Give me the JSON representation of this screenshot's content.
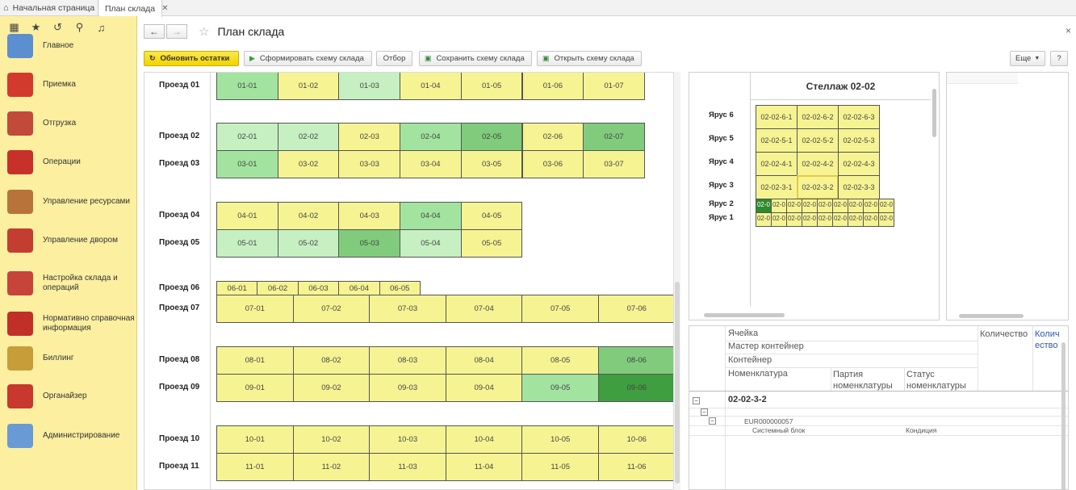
{
  "tabs": {
    "home": "Начальная страница",
    "current": "План склада"
  },
  "sidebar": {
    "items": [
      {
        "label": "Главное",
        "color": "#5b8fd0"
      },
      {
        "label": "Приемка",
        "color": "#d23a2e"
      },
      {
        "label": "Отгрузка",
        "color": "#c24a3a"
      },
      {
        "label": "Операции",
        "color": "#c8302a"
      },
      {
        "label": "Управление ресурсами",
        "color": "#b8733a"
      },
      {
        "label": "Управление двором",
        "color": "#c33d30"
      },
      {
        "label": "Настройка склада и операций",
        "color": "#c7443a"
      },
      {
        "label": "Нормативно справочная информация",
        "color": "#c03028"
      },
      {
        "label": "Биллинг",
        "color": "#c79d3a"
      },
      {
        "label": "Органайзер",
        "color": "#c8382e"
      },
      {
        "label": "Администрирование",
        "color": "#6a9ad6"
      }
    ]
  },
  "header": {
    "title": "План склада",
    "close": "×"
  },
  "toolbar": {
    "refresh": "Обновить остатки",
    "form_scheme": "Сформировать схему склада",
    "filter": "Отбор",
    "save_scheme": "Сохранить схему склада",
    "open_scheme": "Открыть схему склада",
    "more": "Еще",
    "help": "?"
  },
  "colors": {
    "yellow": "#f6f492",
    "light_green": "#c6f0c2",
    "mid_green": "#a3e3a0",
    "green": "#80cc7c",
    "dark_green": "#3f9e3f"
  },
  "passages": [
    {
      "label": "Проезд 01",
      "cells": [
        [
          "01-01",
          "mid_green"
        ],
        [
          "01-02",
          "yellow"
        ],
        [
          "01-03",
          "light_green"
        ],
        [
          "01-04",
          "yellow"
        ],
        [
          "01-05",
          "yellow"
        ],
        [
          "01-06",
          "yellow"
        ],
        [
          "01-07",
          "yellow"
        ]
      ]
    },
    {
      "label": "Проезд 02",
      "cells": [
        [
          "02-01",
          "light_green"
        ],
        [
          "02-02",
          "light_green"
        ],
        [
          "02-03",
          "yellow"
        ],
        [
          "02-04",
          "mid_green"
        ],
        [
          "02-05",
          "green"
        ],
        [
          "02-06",
          "yellow"
        ],
        [
          "02-07",
          "green"
        ]
      ]
    },
    {
      "label": "Проезд 03",
      "cells": [
        [
          "03-01",
          "mid_green"
        ],
        [
          "03-02",
          "yellow"
        ],
        [
          "03-03",
          "yellow"
        ],
        [
          "03-04",
          "yellow"
        ],
        [
          "03-05",
          "yellow"
        ],
        [
          "03-06",
          "yellow"
        ],
        [
          "03-07",
          "yellow"
        ]
      ]
    },
    {
      "label": "Проезд 04",
      "cells": [
        [
          "04-01",
          "yellow"
        ],
        [
          "04-02",
          "yellow"
        ],
        [
          "04-03",
          "yellow"
        ],
        [
          "04-04",
          "mid_green"
        ],
        [
          "04-05",
          "yellow"
        ]
      ]
    },
    {
      "label": "Проезд 05",
      "cells": [
        [
          "05-01",
          "light_green"
        ],
        [
          "05-02",
          "light_green"
        ],
        [
          "05-03",
          "green"
        ],
        [
          "05-04",
          "light_green"
        ],
        [
          "05-05",
          "yellow"
        ]
      ]
    },
    {
      "label": "Проезд 06",
      "cells": [
        [
          "06-01",
          "yellow"
        ],
        [
          "06-02",
          "yellow"
        ],
        [
          "06-03",
          "yellow"
        ],
        [
          "06-04",
          "yellow"
        ],
        [
          "06-05",
          "yellow"
        ]
      ]
    },
    {
      "label": "Проезд 07",
      "cells": [
        [
          "07-01",
          "yellow"
        ],
        [
          "07-02",
          "yellow"
        ],
        [
          "07-03",
          "yellow"
        ],
        [
          "07-04",
          "yellow"
        ],
        [
          "07-05",
          "yellow"
        ],
        [
          "07-06",
          "yellow"
        ]
      ]
    },
    {
      "label": "Проезд 08",
      "cells": [
        [
          "08-01",
          "yellow"
        ],
        [
          "08-02",
          "yellow"
        ],
        [
          "08-03",
          "yellow"
        ],
        [
          "08-04",
          "yellow"
        ],
        [
          "08-05",
          "yellow"
        ],
        [
          "08-06",
          "green"
        ]
      ]
    },
    {
      "label": "Проезд 09",
      "cells": [
        [
          "09-01",
          "yellow"
        ],
        [
          "09-02",
          "yellow"
        ],
        [
          "09-03",
          "yellow"
        ],
        [
          "09-04",
          "yellow"
        ],
        [
          "09-05",
          "mid_green"
        ],
        [
          "09-06",
          "dark_green"
        ]
      ]
    },
    {
      "label": "Проезд 10",
      "cells": [
        [
          "10-01",
          "yellow"
        ],
        [
          "10-02",
          "yellow"
        ],
        [
          "10-03",
          "yellow"
        ],
        [
          "10-04",
          "yellow"
        ],
        [
          "10-05",
          "yellow"
        ],
        [
          "10-06",
          "yellow"
        ]
      ]
    },
    {
      "label": "Проезд 11",
      "cells": [
        [
          "11-01",
          "yellow"
        ],
        [
          "11-02",
          "yellow"
        ],
        [
          "11-03",
          "yellow"
        ],
        [
          "11-04",
          "yellow"
        ],
        [
          "11-05",
          "yellow"
        ],
        [
          "11-06",
          "yellow"
        ]
      ]
    }
  ],
  "rack": {
    "title": "Стеллаж 02-02",
    "tiers": [
      {
        "label": "Ярус 6",
        "cells": [
          "02-02-6-1",
          "02-02-6-2",
          "02-02-6-3"
        ]
      },
      {
        "label": "Ярус 5",
        "cells": [
          "02-02-5-1",
          "02-02-5-2",
          "02-02-5-3"
        ]
      },
      {
        "label": "Ярус 4",
        "cells": [
          "02-02-4-1",
          "02-02-4-2",
          "02-02-4-3"
        ]
      },
      {
        "label": "Ярус 3",
        "cells": [
          "02-02-3-1",
          "02-02-3-2",
          "02-02-3-3"
        ]
      },
      {
        "label": "Ярус 2",
        "cells": [
          "02-0",
          "02-0",
          "02-0",
          "02-0",
          "02-0",
          "02-0",
          "02-0",
          "02-0",
          "02-0"
        ]
      },
      {
        "label": "Ярус 1",
        "cells": [
          "02-0",
          "02-0",
          "02-0",
          "02-0",
          "02-0",
          "02-0",
          "02-0",
          "02-0",
          "02-0"
        ]
      }
    ]
  },
  "details": {
    "col_cell": "Ячейка",
    "col_master": "Мастер контейнер",
    "col_container": "Контейнер",
    "col_nomenclature": "Номенклатура",
    "col_batch": "Партия номенклатуры",
    "col_status": "Статус номенклатуры",
    "col_qty": "Количество",
    "col_qty_plan": "Количество план",
    "row_cell": "02-02-3-2",
    "row_container": "EUR000000057",
    "row_item": "Системный блок",
    "row_condition": "Кондиция"
  }
}
